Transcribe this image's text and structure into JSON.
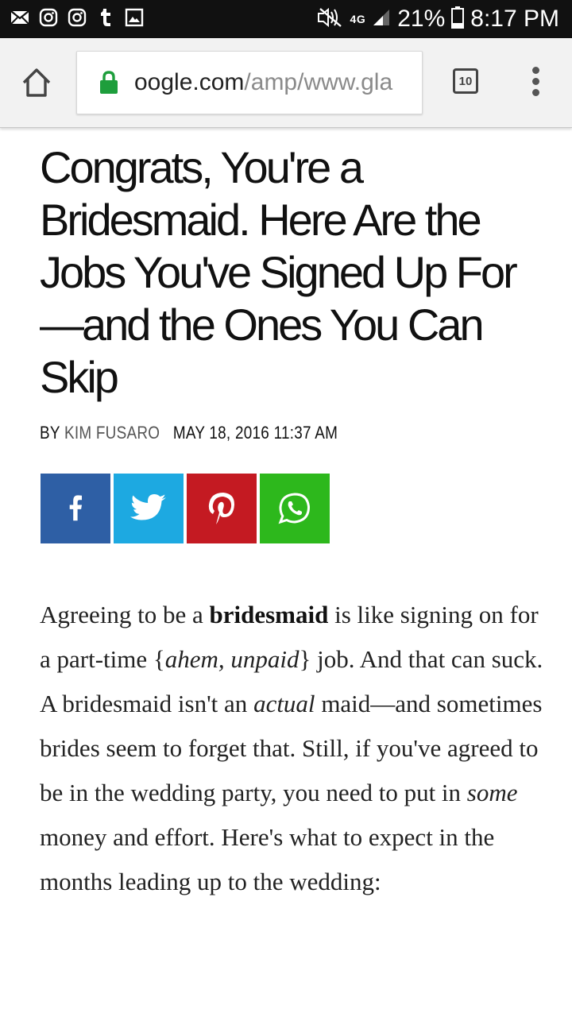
{
  "status_bar": {
    "network": "4G",
    "battery": "21%",
    "time": "8:17 PM",
    "notification_icons": [
      "mail-icon",
      "instagram-icon",
      "instagram-icon",
      "tumblr-icon",
      "gallery-icon"
    ]
  },
  "browser": {
    "url_host": "oogle.com",
    "url_path": "/amp/www.gla",
    "tab_count": "10"
  },
  "article": {
    "headline": "Congrats, You're a Bridesmaid. Here Are the Jobs You've Signed Up For—and the Ones You Can Skip",
    "by_label": "BY",
    "author": "KIM FUSARO",
    "date": "MAY 18, 2016 11:37 AM",
    "share_buttons": [
      "facebook-icon",
      "twitter-icon",
      "pinterest-icon",
      "whatsapp-icon"
    ],
    "body": {
      "p1": "Agreeing to be a ",
      "bold1": "bridesmaid",
      "p2": " is like signing on for a part-time {",
      "ital1": "ahem, unpaid",
      "p3": "} job. And that can suck. A bridesmaid isn't an ",
      "ital2": "actual",
      "p4": " maid—and sometimes brides seem to forget that. Still, if you've agreed to be in the wedding party, you need to put in ",
      "ital3": "some",
      "p5": " money and effort. Here's what to expect in the months leading up to the wedding:"
    }
  },
  "colors": {
    "facebook": "#2e5fa5",
    "twitter": "#1da9e1",
    "pinterest": "#c41a22",
    "whatsapp": "#2db81c",
    "lock": "#1e9e3c"
  }
}
